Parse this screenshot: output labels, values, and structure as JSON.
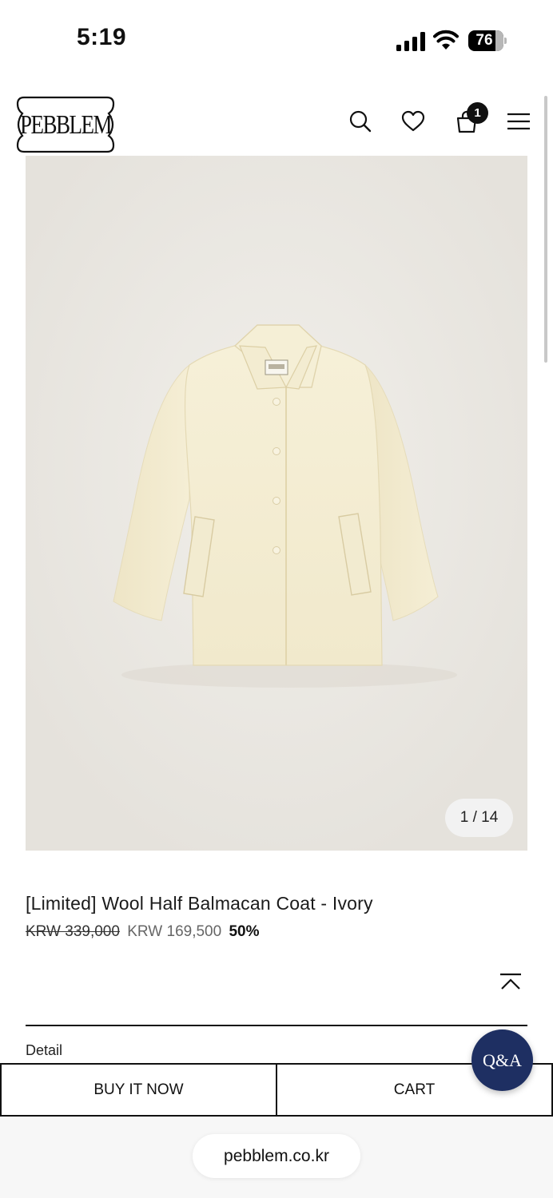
{
  "status_bar": {
    "time": "5:19",
    "battery": "76",
    "signal_icon": "cellular-signal-icon",
    "wifi_icon": "wifi-icon"
  },
  "header": {
    "logo_text": "PEBBLEM",
    "icons": [
      "search-icon",
      "heart-icon",
      "shopping-bag-icon",
      "menu-icon"
    ],
    "cart_count": "1"
  },
  "product": {
    "image_label_text": "PEBBLEM",
    "image_counter": "1 / 14",
    "title": "[Limited] Wool Half Balmacan Coat - Ivory",
    "original_price": "KRW 339,000",
    "sale_price": "KRW 169,500",
    "discount": "50%",
    "detail_label": "Detail"
  },
  "actions": {
    "buy_now": "BUY IT NOW",
    "cart": "CART",
    "qa": "Q&A"
  },
  "browser": {
    "url": "pebblem.co.kr"
  },
  "colors": {
    "qa_button": "#1e2f62",
    "background": "#ffffff",
    "image_background": "#ebe8e3",
    "coat": "#f4eed5"
  }
}
